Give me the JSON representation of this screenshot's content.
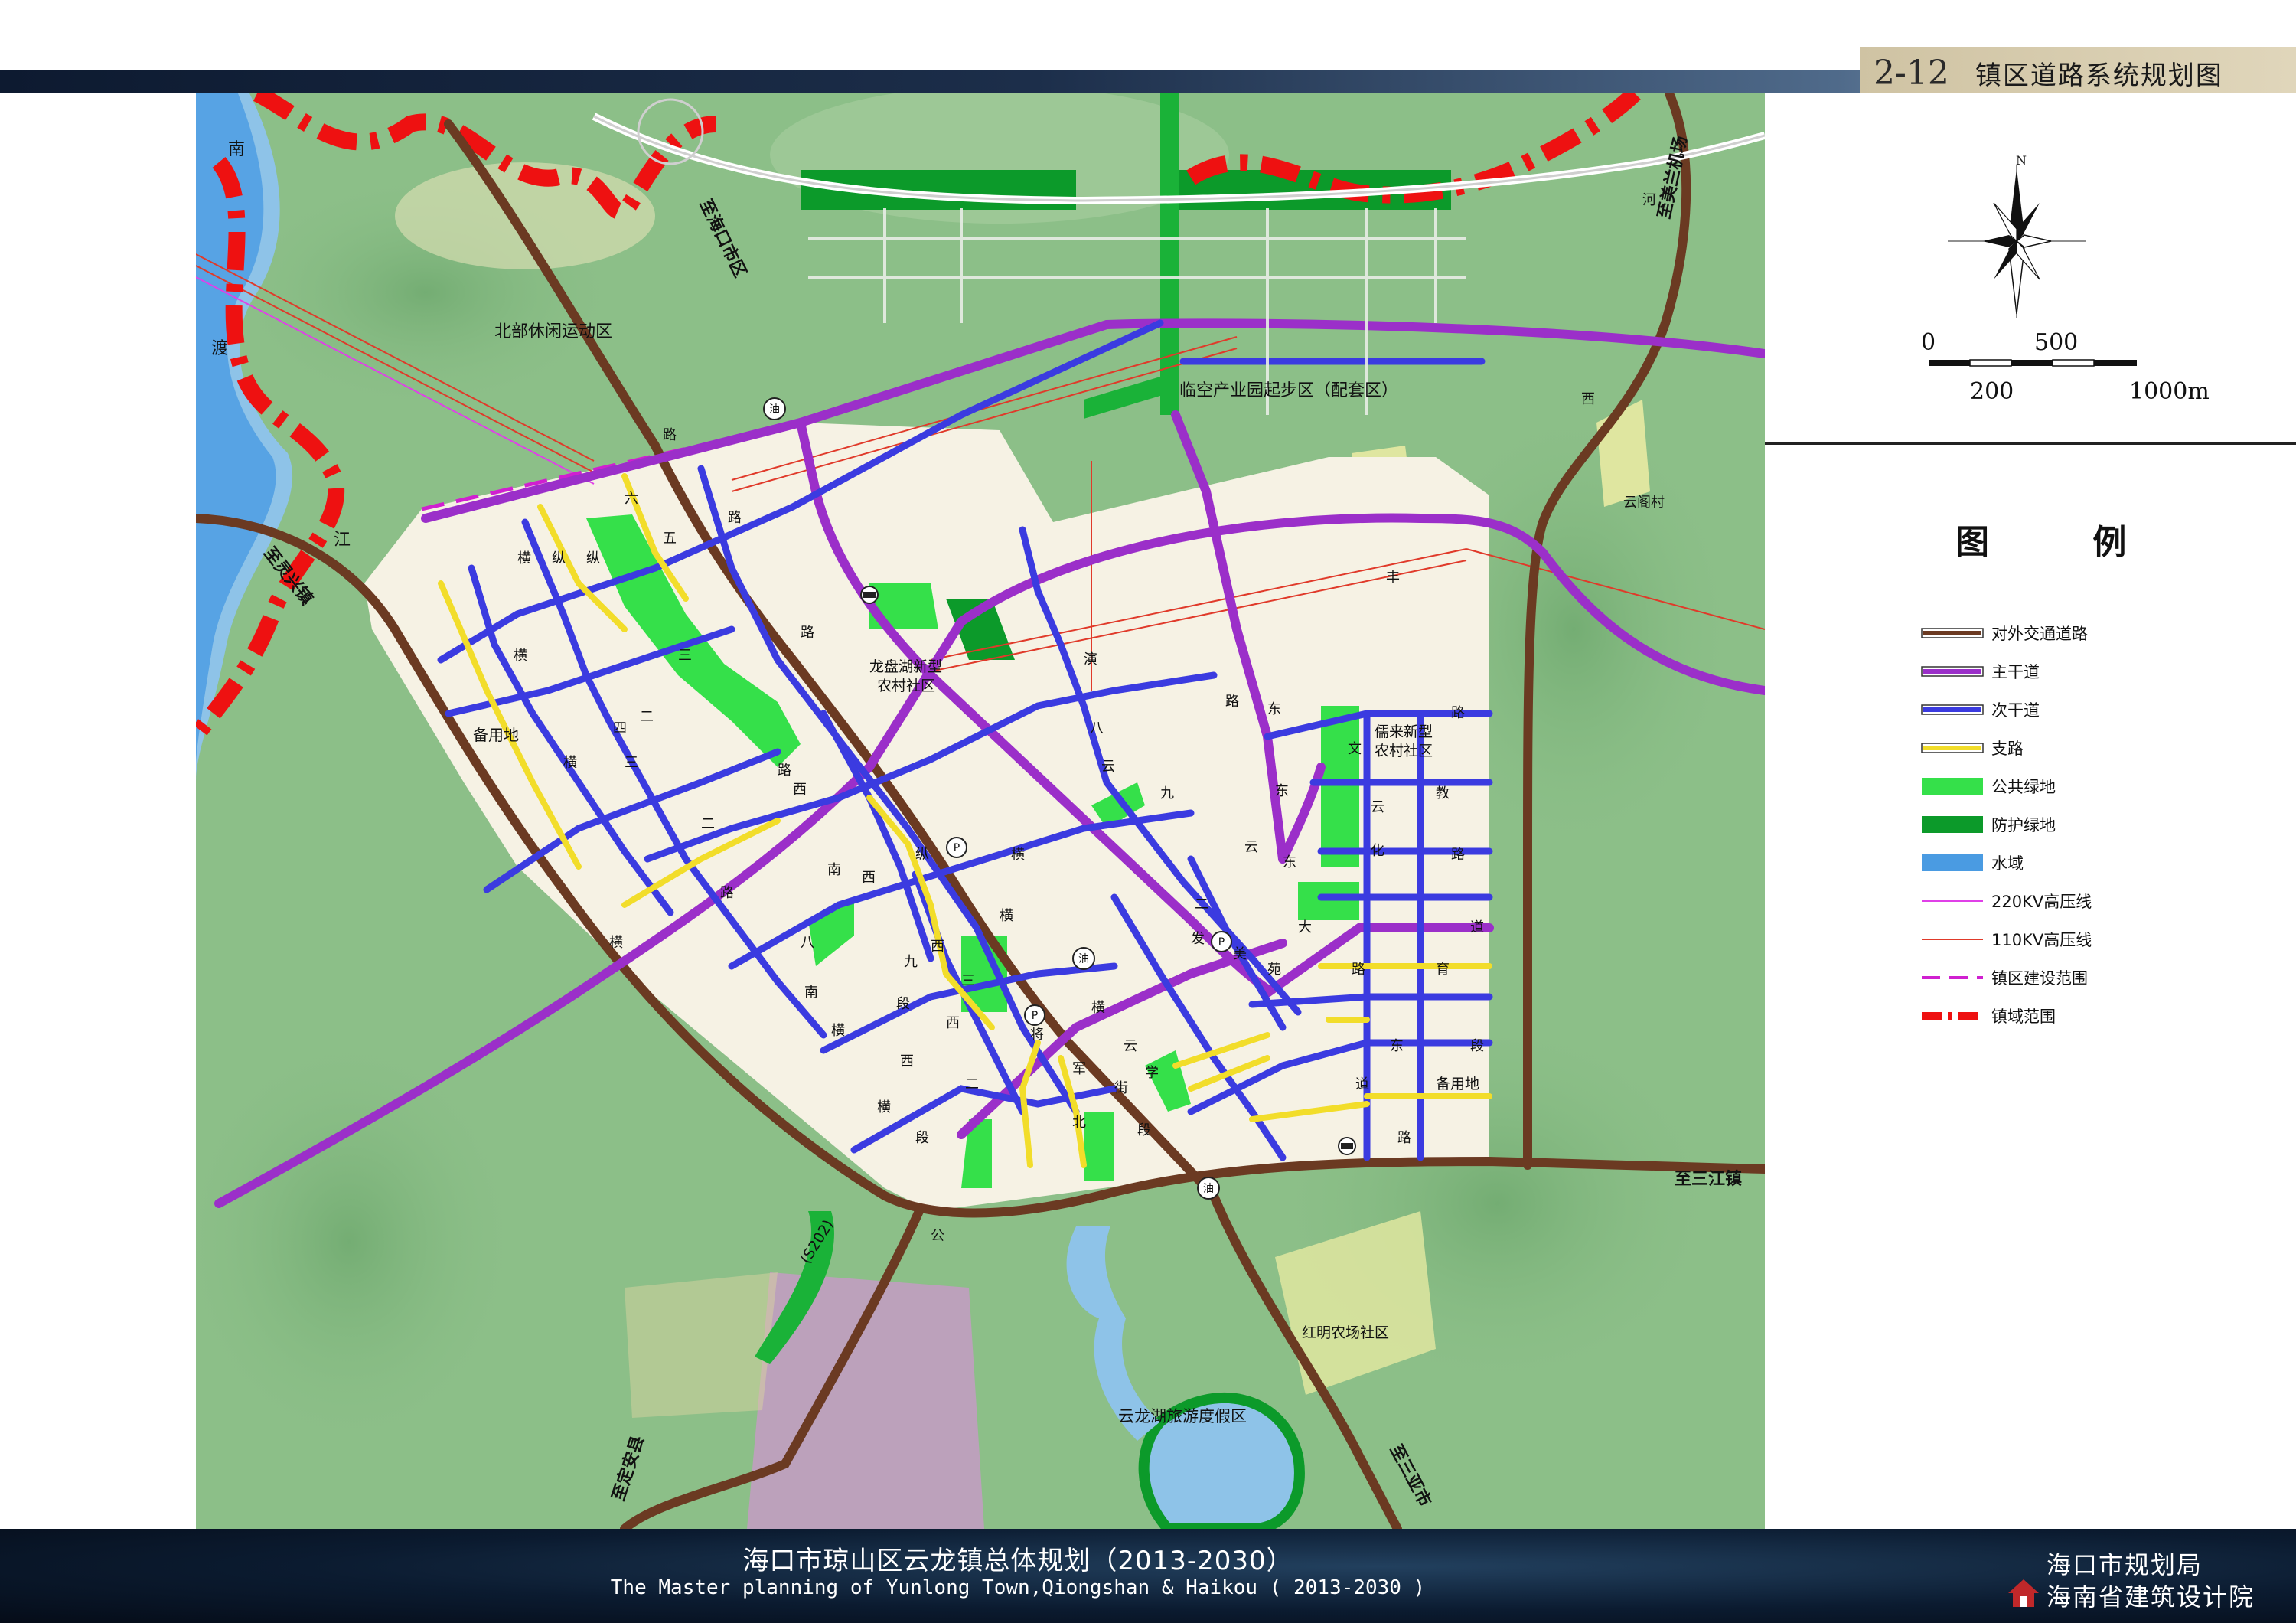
{
  "header": {
    "plate_number": "2-12",
    "plate_title": "镇区道路系统规划图"
  },
  "footer": {
    "title_cn": "海口市琼山区云龙镇总体规划（2013-2030）",
    "title_en": "The Master planning of Yunlong Town,Qiongshan & Haikou ( 2013-2030 )",
    "org_1": "海口市规划局",
    "org_2": "海南省建筑设计院"
  },
  "compass": {
    "label": "N"
  },
  "scale": {
    "labels_top": [
      "0",
      "500"
    ],
    "labels_bottom": [
      "200",
      "1000m"
    ]
  },
  "legend": {
    "title": "图 例",
    "items": [
      {
        "label": "对外交通道路",
        "color": "#6b3a22",
        "style": "road"
      },
      {
        "label": "主干道",
        "color": "#9b2fc9",
        "style": "line"
      },
      {
        "label": "次干道",
        "color": "#3b3be0",
        "style": "line"
      },
      {
        "label": "支路",
        "color": "#f2dd2a",
        "style": "line"
      },
      {
        "label": "公共绿地",
        "color": "#35e04a",
        "style": "fill"
      },
      {
        "label": "防护绿地",
        "color": "#0c9a2a",
        "style": "fill"
      },
      {
        "label": "水域",
        "color": "#4a9be2",
        "style": "fill"
      },
      {
        "label": "220KV高压线",
        "color": "#e040e8",
        "style": "thin"
      },
      {
        "label": "110KV高压线",
        "color": "#e03a2a",
        "style": "thin"
      },
      {
        "label": "镇区建设范围",
        "color": "#d020d0",
        "style": "dash"
      },
      {
        "label": "镇域范围",
        "color": "#ee1111",
        "style": "dashdot"
      }
    ]
  },
  "map_labels": {
    "north_leisure": "北部休闲运动区",
    "airport_park": "临空产业园起步区（配套区）",
    "longpan": "龙盘湖新型",
    "longpan2": "农村社区",
    "rulai": "儒来新型",
    "rulai2": "农村社区",
    "reserve_west": "备用地",
    "reserve_east": "备用地",
    "yunge": "云阁村",
    "hongming": "红明农场社区",
    "resort": "云龙湖旅游度假区",
    "to_haikou": "至海口市区",
    "to_meilan": "至美兰机场",
    "to_lingxing": "至灵兴镇",
    "to_sanjiang": "至三江镇",
    "to_dingan": "至定安县",
    "to_sanya": "至三亚市",
    "s202": "(S202)",
    "river_nan": "南",
    "river_du": "渡",
    "river_jiang": "江",
    "you": "油",
    "gas": "P"
  },
  "road_chars": {
    "liu": "六",
    "wu": "五",
    "heng": "横",
    "zong": "纵",
    "lu": "路",
    "er": "二",
    "san": "三",
    "si": "四",
    "xi": "西",
    "nan": "南",
    "ba": "八",
    "jiu": "九",
    "duan": "段",
    "yun": "云",
    "dong": "东",
    "wen": "文",
    "hua": "化",
    "jiao": "教",
    "yu": "育",
    "da": "大",
    "dao": "道",
    "fa": "发",
    "mei": "美",
    "yuan": "苑",
    "jiang": "将",
    "jun": "军",
    "jie": "街",
    "xue": "学",
    "bei": "北",
    "yi": "一",
    "feng": "丰",
    "yan": "演",
    "he": "河",
    "gong": "公"
  },
  "colors": {
    "background_green": "#8cbf88",
    "urban_fill": "#f6f2e4",
    "external_road": "#6b3a22",
    "arterial": "#9b2fc9",
    "secondary": "#3b3be0",
    "branch": "#f2dd2a",
    "public_green": "#35e04a",
    "protective_green": "#0c9a2a",
    "water": "#4a9be2"
  }
}
